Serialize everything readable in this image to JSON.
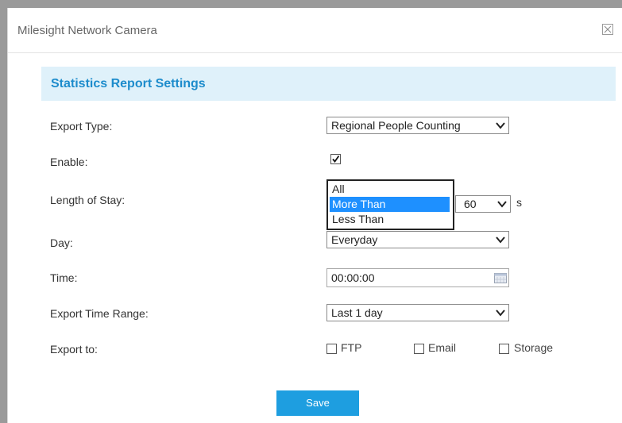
{
  "window": {
    "title": "Milesight Network Camera"
  },
  "section": {
    "title": "Statistics Report Settings"
  },
  "form": {
    "export_type": {
      "label": "Export Type:",
      "value": "Regional People Counting"
    },
    "enable": {
      "label": "Enable:",
      "checked": true
    },
    "length_of_stay": {
      "label": "Length of Stay:",
      "options": [
        "All",
        "More Than",
        "Less Than"
      ],
      "selected": "More Than",
      "seconds_value": "60",
      "unit": "s"
    },
    "day": {
      "label": "Day:",
      "value": "Everyday"
    },
    "time": {
      "label": "Time:",
      "value": "00:00:00"
    },
    "export_time_range": {
      "label": "Export Time Range:",
      "value": "Last 1 day"
    },
    "export_to": {
      "label": "Export to:",
      "options": [
        {
          "label": "FTP",
          "checked": false
        },
        {
          "label": "Email",
          "checked": false
        },
        {
          "label": "Storage",
          "checked": false
        }
      ]
    }
  },
  "buttons": {
    "save": "Save"
  },
  "colors": {
    "accent": "#1d8ccc",
    "header_bg": "#dff1fa",
    "button_bg": "#1e9ee0",
    "selection": "#1e90ff"
  },
  "icons": [
    "close-icon",
    "chevron-down-icon",
    "checkmark-icon",
    "calendar-icon"
  ]
}
